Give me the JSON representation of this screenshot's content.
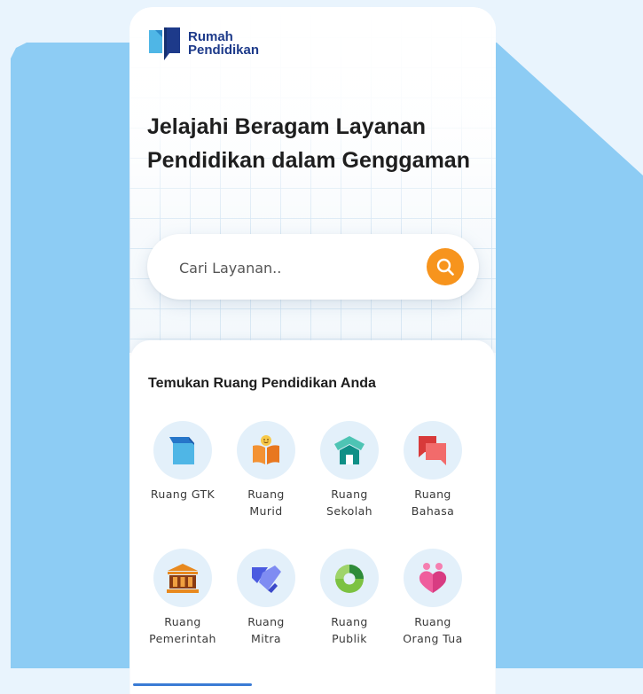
{
  "brand": {
    "name_line1": "Rumah",
    "name_line2": "Pendidikan",
    "color_primary": "#1d3a8a",
    "color_accent": "#4fb6e6"
  },
  "hero": {
    "headline": "Jelajahi Beragam Layanan Pendidikan dalam Genggaman"
  },
  "search": {
    "placeholder": "Cari Layanan..",
    "button_icon": "search-icon",
    "button_color": "#f7941d"
  },
  "services": {
    "title": "Temukan Ruang Pendidikan Anda",
    "items": [
      {
        "label": "Ruang GTK",
        "icon": "gtk-book-icon"
      },
      {
        "label": "Ruang\nMurid",
        "icon": "student-book-icon"
      },
      {
        "label": "Ruang\nSekolah",
        "icon": "school-building-icon"
      },
      {
        "label": "Ruang\nBahasa",
        "icon": "chat-bubbles-icon"
      },
      {
        "label": "Ruang\nPemerintah",
        "icon": "government-building-icon"
      },
      {
        "label": "Ruang\nMitra",
        "icon": "handshake-icon"
      },
      {
        "label": "Ruang\nPublik",
        "icon": "donut-chart-icon"
      },
      {
        "label": "Ruang\nOrang Tua",
        "icon": "parents-heart-icon"
      }
    ]
  },
  "colors": {
    "page_background": "#e9f4fd",
    "backdrop_shape": "#8dccf4",
    "icon_circle": "#e3f0fa"
  }
}
